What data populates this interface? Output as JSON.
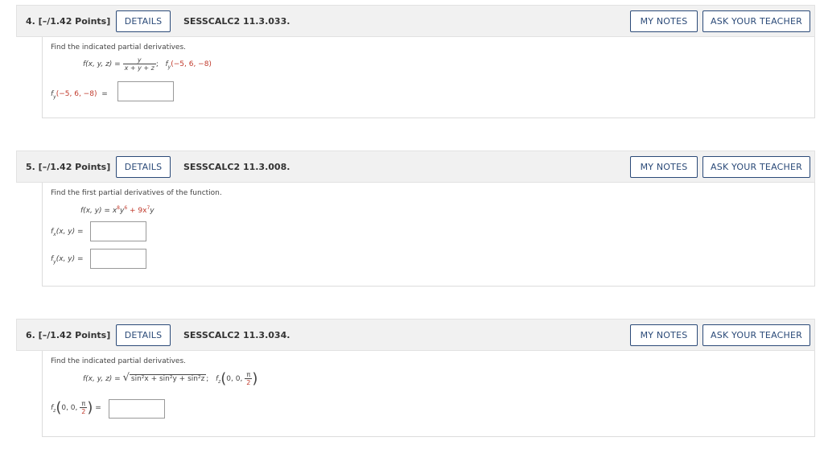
{
  "questions": [
    {
      "number": "4.  [–/1.42 Points]",
      "details_label": "DETAILS",
      "code": "SESSCALC2 11.3.033.",
      "notes_label": "MY NOTES",
      "ask_label": "ASK YOUR TEACHER",
      "prompt": "Find the indicated partial derivatives.",
      "func_prefix": "f(x, y, z) =",
      "frac_num": "y",
      "frac_den": "x + y + z",
      "func_suffix": ";",
      "target_prefix": "f",
      "target_sub": "y",
      "target_args": "(−5, 6, −8)",
      "answer_prefix": "f",
      "answer_sub": "y",
      "answer_args": "(−5, 6, −8)",
      "answer_eq": "=",
      "answer_value": ""
    },
    {
      "number": "5.  [–/1.42 Points]",
      "details_label": "DETAILS",
      "code": "SESSCALC2 11.3.008.",
      "notes_label": "MY NOTES",
      "ask_label": "ASK YOUR TEACHER",
      "prompt": "Find the first partial derivatives of the function.",
      "func_prefix": "f(x, y) = x",
      "exp1": "8",
      "mid1": "y",
      "exp2": "6",
      "plus": " + 9x",
      "exp3": "7",
      "tail": "y",
      "fx_label": "f",
      "fx_sub": "x",
      "fx_args": "(x, y) =",
      "fy_label": "f",
      "fy_sub": "y",
      "fy_args": "(x, y) =",
      "fx_value": "",
      "fy_value": ""
    },
    {
      "number": "6.  [–/1.42 Points]",
      "details_label": "DETAILS",
      "code": "SESSCALC2 11.3.034.",
      "notes_label": "MY NOTES",
      "ask_label": "ASK YOUR TEACHER",
      "prompt": "Find the indicated partial derivatives.",
      "func_prefix": "f(x, y, z) =",
      "sqrt_body": "sin²x + sin²y + sin²z",
      "func_suffix": ";",
      "target_prefix": "f",
      "target_sub": "z",
      "target_args": "0, 0,",
      "pi": "π",
      "two": "2",
      "answer_prefix": "f",
      "answer_sub": "z",
      "answer_args": "0, 0,",
      "answer_eq": "=",
      "answer_value": ""
    }
  ],
  "colors": {
    "header_bg": "#f1f1f1",
    "button_border": "#2b4a78",
    "accent_red": "#c0392b"
  }
}
